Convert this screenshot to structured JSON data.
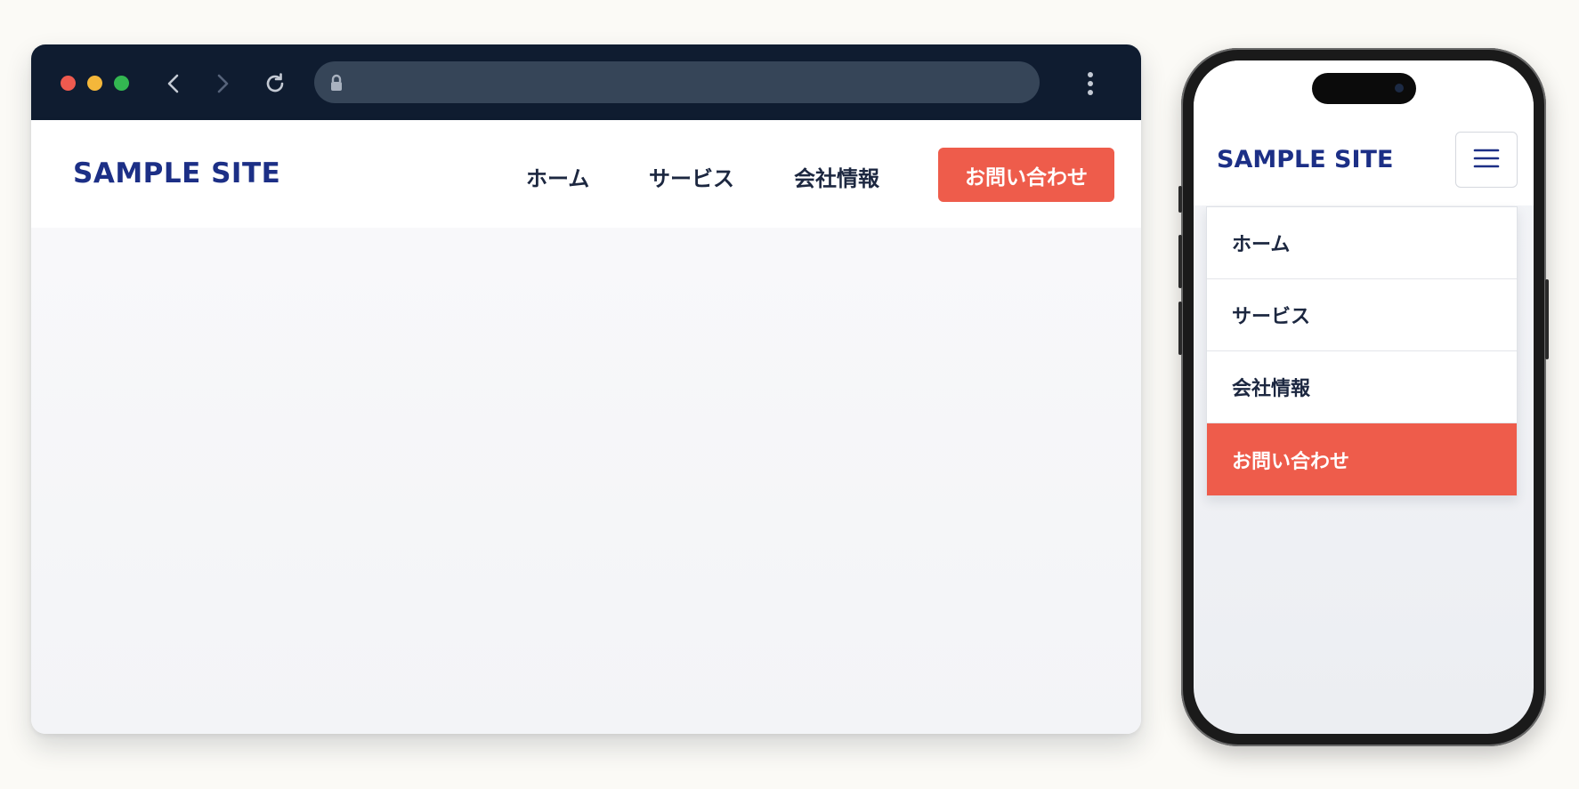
{
  "colors": {
    "brand": "#1c2f86",
    "accent": "#ee5c4b",
    "browser_chrome": "#0f1c30",
    "nav_text": "#1c2740"
  },
  "desktop": {
    "logo": "SAMPLE SITE",
    "nav": {
      "home": "ホーム",
      "services": "サービス",
      "company": "会社情報",
      "contact": "お問い合わせ"
    },
    "address_bar": {
      "url": ""
    },
    "icons": [
      "back-icon",
      "forward-icon",
      "reload-icon",
      "lock-icon",
      "menu-dots-icon"
    ]
  },
  "mobile": {
    "logo": "SAMPLE SITE",
    "menu_open": true,
    "menu": {
      "home": "ホーム",
      "services": "サービス",
      "company": "会社情報",
      "contact": "お問い合わせ"
    },
    "icons": [
      "hamburger-icon"
    ]
  }
}
